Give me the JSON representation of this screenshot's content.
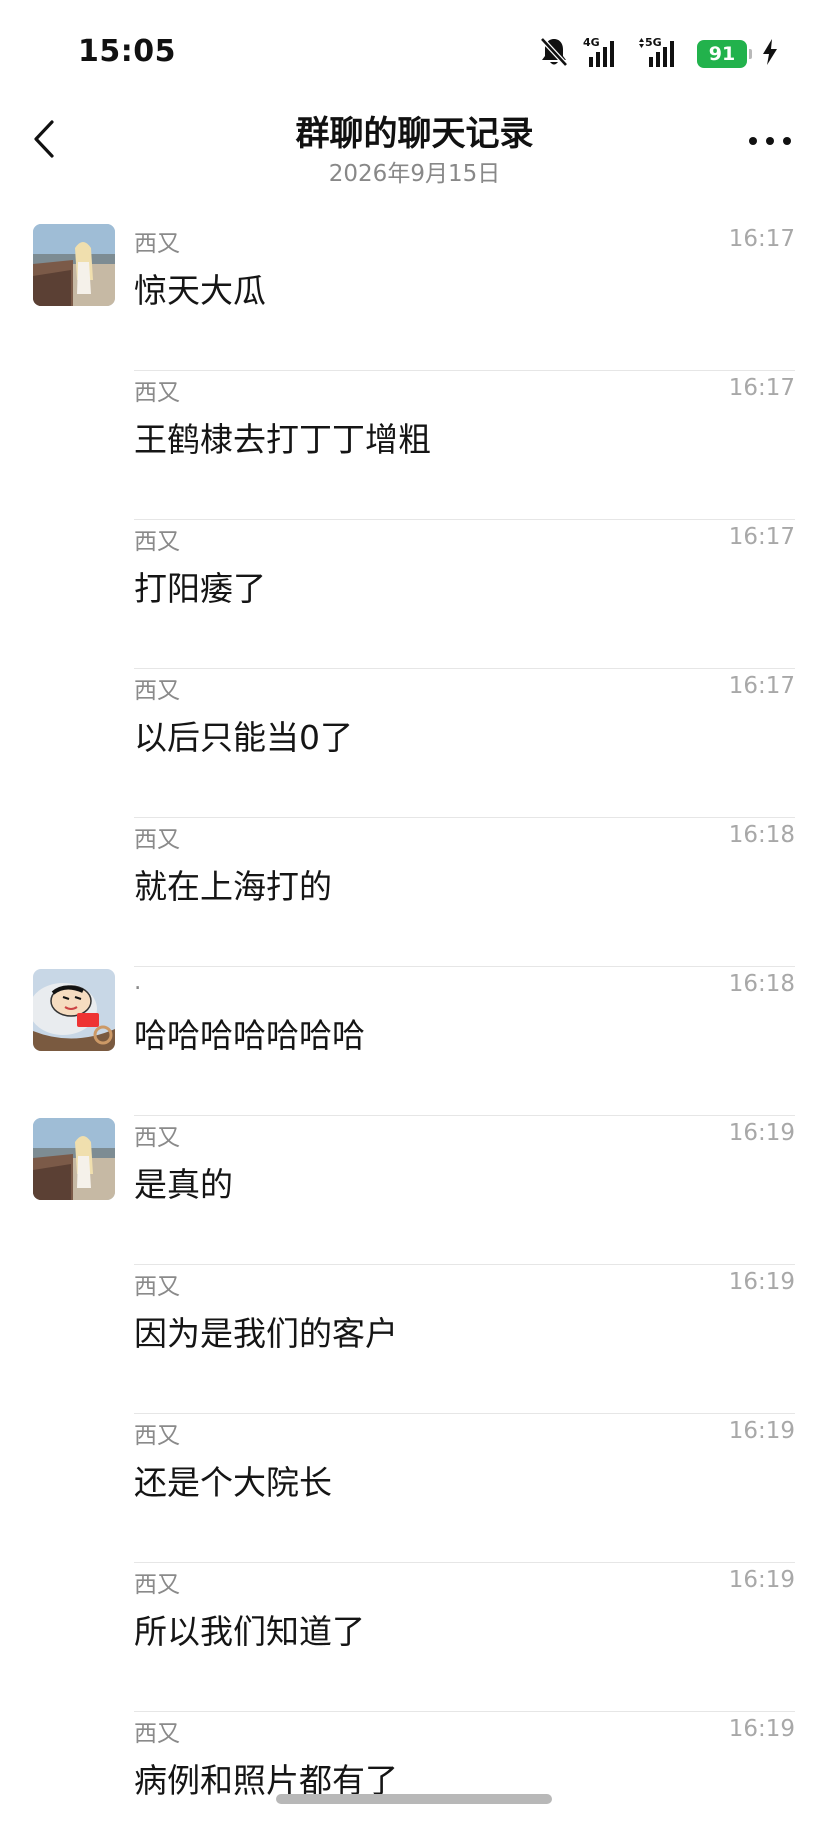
{
  "status_bar": {
    "time": "15:05",
    "net1": "4G",
    "net2": "5G",
    "battery": "91",
    "icons": [
      "mute-bell-icon",
      "signal-4g-icon",
      "signal-5g-icon",
      "battery-icon",
      "charging-icon"
    ],
    "battery_color": "#22b24c"
  },
  "nav": {
    "title": "群聊的聊天记录",
    "subtitle": "2026年9月15日",
    "back_icon": "chevron-left-icon",
    "more_icon": "more-dots-icon"
  },
  "messages": [
    {
      "sender": "西又",
      "time": "16:17",
      "text": "惊天大瓜",
      "avatar": "photo-avatar"
    },
    {
      "sender": "西又",
      "time": "16:17",
      "text": "王鹤棣去打丁丁增粗",
      "avatar": ""
    },
    {
      "sender": "西又",
      "time": "16:17",
      "text": "打阳痿了",
      "avatar": ""
    },
    {
      "sender": "西又",
      "time": "16:17",
      "text": "以后只能当0了",
      "avatar": ""
    },
    {
      "sender": "西又",
      "time": "16:18",
      "text": "就在上海打的",
      "avatar": ""
    },
    {
      "sender": ".",
      "time": "16:18",
      "text": "哈哈哈哈哈哈哈",
      "avatar": "cartoon-avatar"
    },
    {
      "sender": "西又",
      "time": "16:19",
      "text": "是真的",
      "avatar": "photo-avatar"
    },
    {
      "sender": "西又",
      "time": "16:19",
      "text": "因为是我们的客户",
      "avatar": ""
    },
    {
      "sender": "西又",
      "time": "16:19",
      "text": "还是个大院长",
      "avatar": ""
    },
    {
      "sender": "西又",
      "time": "16:19",
      "text": "所以我们知道了",
      "avatar": ""
    },
    {
      "sender": "西又",
      "time": "16:19",
      "text": "病例和照片都有了",
      "avatar": ""
    }
  ]
}
